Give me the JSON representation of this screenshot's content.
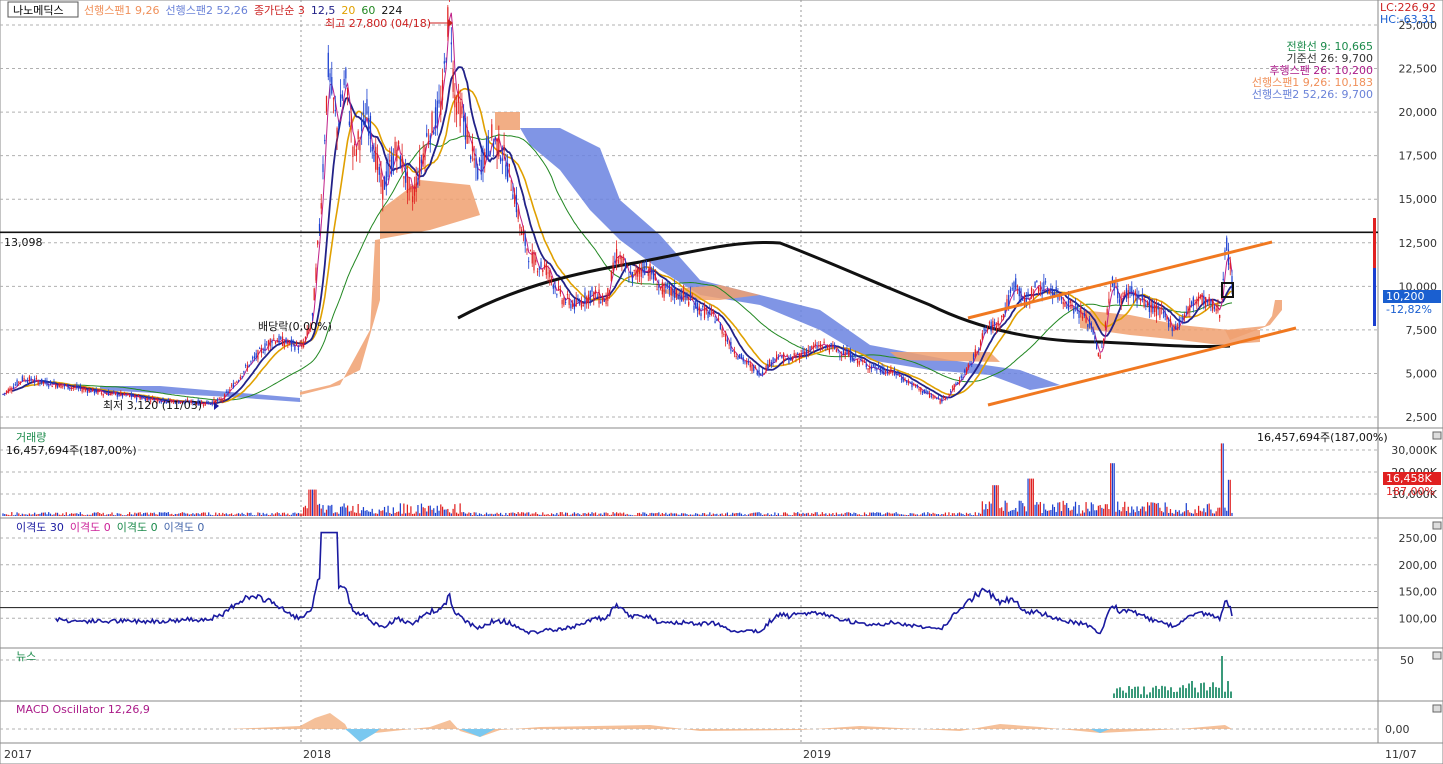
{
  "stock_name": "나노메딕스",
  "legend_items": [
    {
      "text": "선행스팬1 9,26",
      "color": "#f0905a"
    },
    {
      "text": "선행스팬2 52,26",
      "color": "#6a82d8"
    },
    {
      "text": "종가단순 3",
      "color": "#cc2222"
    },
    {
      "text": "12,5",
      "color": "#222288"
    },
    {
      "text": "20",
      "color": "#e0a000"
    },
    {
      "text": "60",
      "color": "#228822"
    },
    {
      "text": "224",
      "color": "#111111"
    }
  ],
  "top_right": {
    "lc": "LC:226,92",
    "hc": "HC:-63,31"
  },
  "ichimoku_values": [
    {
      "text": "전환선 9: 10,665",
      "color": "#1a8a4a"
    },
    {
      "text": "기준선 26: 9,700",
      "color": "#333333"
    },
    {
      "text": "후행스팬 26: 10,200",
      "color": "#aa1a88"
    },
    {
      "text": "선행스팬1 9,26: 10,183",
      "color": "#f0905a"
    },
    {
      "text": "선행스팬2 52,26: 9,700",
      "color": "#6a82d8"
    }
  ],
  "annotations": {
    "high": "최고 27,800 (04/18)",
    "low": "최저 3,120 (11/03)",
    "dividend": "배당락(0,00%)",
    "hline_label": "13,098",
    "price_box": "10,200",
    "price_pct": "-12,82%"
  },
  "panels": {
    "volume": {
      "title": "거래량",
      "left_value": "16,457,694주(187,00%)",
      "right_value": "16,457,694주(187,00%)",
      "box_value": "16,458K",
      "box_pct": "187,00%"
    },
    "disparity": {
      "title_parts": [
        {
          "text": "이격도 30",
          "color": "#1a1aa0"
        },
        {
          "text": "이격도 0",
          "color": "#cc2299"
        },
        {
          "text": "이격도 0",
          "color": "#1a8a4a"
        },
        {
          "text": "이격도 0",
          "color": "#4466aa"
        }
      ]
    },
    "news": {
      "title": "뉴스"
    },
    "macd": {
      "title": "MACD Oscillator 12,26,9"
    }
  },
  "x_axis_labels": [
    "2017",
    "2018",
    "2019",
    "11/07"
  ],
  "colors": {
    "up": "#e02020",
    "down": "#1a3fd0",
    "ma224": "#111111",
    "ma20": "#e0a000",
    "ma60": "#228822",
    "ma12": "#222288",
    "channel": "#f07820",
    "cloud_pos": "#f0a070",
    "cloud_neg": "#6a82e0",
    "disparity": "#1a1aa0",
    "news": "#3a9a7a"
  },
  "chart_data": [
    {
      "type": "candlestick",
      "title": "나노메딕스",
      "y_ticks": [
        "2,500",
        "5,000",
        "7,500",
        "10,000",
        "12,500",
        "15,000",
        "17,500",
        "20,000",
        "22,500",
        "25,000"
      ],
      "ylim": [
        2000,
        28200
      ],
      "horizontal_line": 13098,
      "x_labels": [
        "2017",
        "2018",
        "2019"
      ],
      "close_series_approx": [
        {
          "x": "2017-01",
          "y": 4200
        },
        {
          "x": "2017-03",
          "y": 4600
        },
        {
          "x": "2017-05",
          "y": 4100
        },
        {
          "x": "2017-07",
          "y": 3700
        },
        {
          "x": "2017-09",
          "y": 3400
        },
        {
          "x": "2017-11",
          "y": 3200
        },
        {
          "x": "2017-12",
          "y": 5600
        },
        {
          "x": "2018-01",
          "y": 7000
        },
        {
          "x": "2018-02",
          "y": 22000
        },
        {
          "x": "2018-03",
          "y": 17000
        },
        {
          "x": "2018-04",
          "y": 24000
        },
        {
          "x": "2018-05",
          "y": 18500
        },
        {
          "x": "2018-06",
          "y": 17000
        },
        {
          "x": "2018-07",
          "y": 12000
        },
        {
          "x": "2018-08",
          "y": 10500
        },
        {
          "x": "2018-09",
          "y": 10800
        },
        {
          "x": "2018-10",
          "y": 9500
        },
        {
          "x": "2018-11",
          "y": 8500
        },
        {
          "x": "2018-12",
          "y": 7000
        },
        {
          "x": "2019-01",
          "y": 5600
        },
        {
          "x": "2019-02",
          "y": 6200
        },
        {
          "x": "2019-03",
          "y": 6000
        },
        {
          "x": "2019-04",
          "y": 5200
        },
        {
          "x": "2019-05",
          "y": 4600
        },
        {
          "x": "2019-06",
          "y": 8200
        },
        {
          "x": "2019-07",
          "y": 9200
        },
        {
          "x": "2019-08",
          "y": 7000
        },
        {
          "x": "2019-09",
          "y": 7800
        },
        {
          "x": "2019-10",
          "y": 8000
        },
        {
          "x": "2019-11",
          "y": 11700
        }
      ],
      "high": 27800,
      "low": 3120
    },
    {
      "type": "bar",
      "title": "거래량",
      "y_ticks": [
        "10,000K",
        "20,000K",
        "30,000K"
      ],
      "last_value": 16457694
    },
    {
      "type": "line",
      "title": "이격도 30",
      "y_ticks": [
        "100,00",
        "150,00",
        "200,00",
        "250,00"
      ],
      "reference_line": 120,
      "x_values_approx": [
        {
          "x": "2017-03",
          "y": 100
        },
        {
          "x": "2017-10",
          "y": 98
        },
        {
          "x": "2017-12",
          "y": 135
        },
        {
          "x": "2018-02",
          "y": 255
        },
        {
          "x": "2018-03",
          "y": 145
        },
        {
          "x": "2018-05",
          "y": 95
        },
        {
          "x": "2018-09",
          "y": 125
        },
        {
          "x": "2019-01",
          "y": 80
        },
        {
          "x": "2019-06",
          "y": 165
        },
        {
          "x": "2019-09",
          "y": 75
        },
        {
          "x": "2019-11",
          "y": 115
        }
      ]
    },
    {
      "type": "bar",
      "title": "뉴스",
      "y_ticks": [
        "50"
      ]
    },
    {
      "type": "area",
      "title": "MACD Oscillator 12,26,9",
      "y_ticks": [
        "0,00"
      ]
    }
  ]
}
